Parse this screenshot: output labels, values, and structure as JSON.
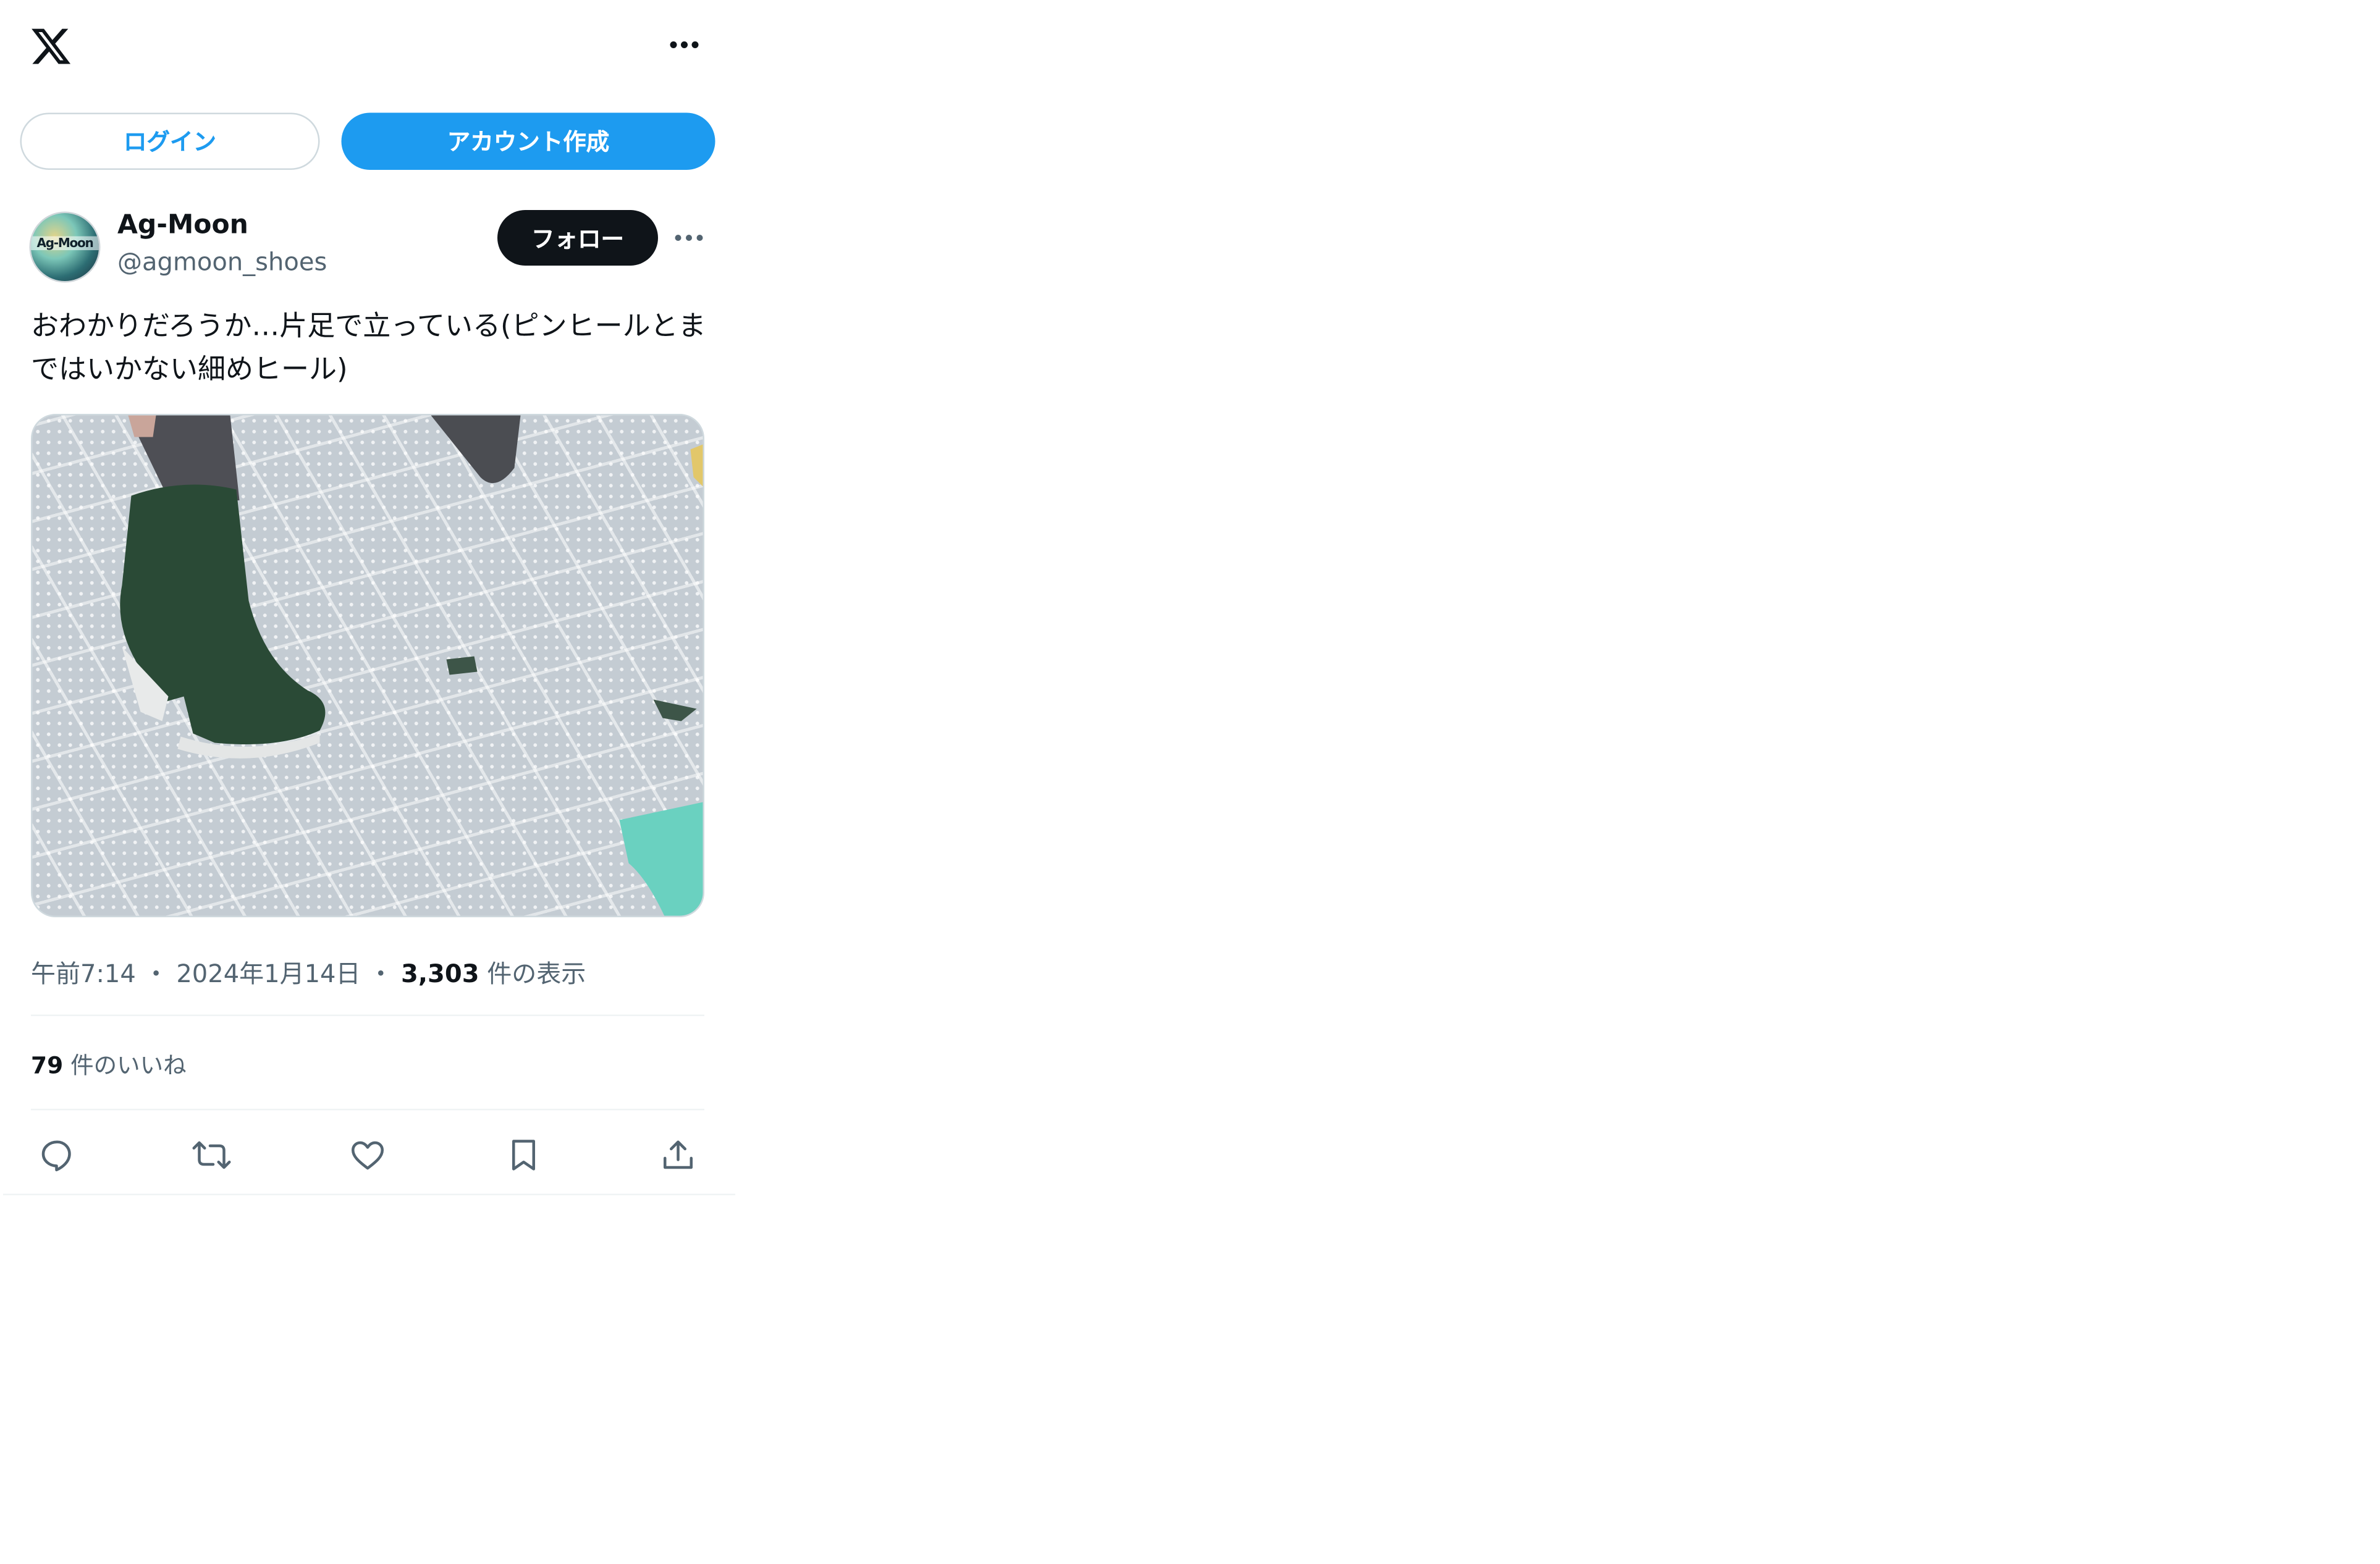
{
  "topbar": {
    "logo_icon": "x-logo-icon",
    "more_icon": "more-horizontal-icon"
  },
  "auth": {
    "login_label": "ログイン",
    "signup_label": "アカウント作成"
  },
  "tweet": {
    "author": {
      "name": "Ag-Moon",
      "handle": "@agmoon_shoes",
      "avatar_text": "Ag-Moon"
    },
    "follow_label": "フォロー",
    "text": "おわかりだろうか…片足で立っている(ピンヒールとまではいかない細めヒール)",
    "meta": {
      "time": "午前7:14",
      "separator": "・",
      "date": "2024年1月14日",
      "views_count": "3,303",
      "views_label": "件の表示"
    },
    "likes": {
      "count": "79",
      "label": "件のいいね"
    },
    "actions": {
      "reply_icon": "reply-icon",
      "retweet_icon": "retweet-icon",
      "like_icon": "heart-icon",
      "bookmark_icon": "bookmark-icon",
      "share_icon": "share-icon"
    }
  },
  "colors": {
    "accent": "#1d9bf0",
    "text": "#0f1419",
    "secondary_text": "#536471",
    "border": "#cfd9de"
  }
}
